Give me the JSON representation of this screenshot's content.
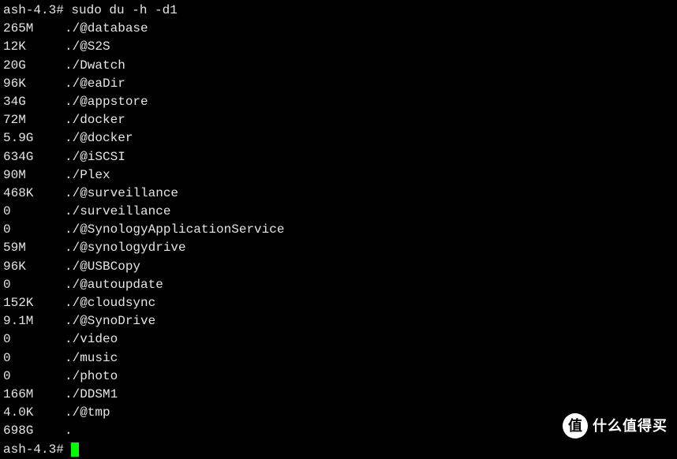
{
  "prompt": "ash-4.3#",
  "command": "sudo du -h -d1",
  "entries": [
    {
      "size": "265M",
      "path": "./@database"
    },
    {
      "size": "12K",
      "path": "./@S2S"
    },
    {
      "size": "20G",
      "path": "./Dwatch"
    },
    {
      "size": "96K",
      "path": "./@eaDir"
    },
    {
      "size": "34G",
      "path": "./@appstore"
    },
    {
      "size": "72M",
      "path": "./docker"
    },
    {
      "size": "5.9G",
      "path": "./@docker"
    },
    {
      "size": "634G",
      "path": "./@iSCSI"
    },
    {
      "size": "90M",
      "path": "./Plex"
    },
    {
      "size": "468K",
      "path": "./@surveillance"
    },
    {
      "size": "0",
      "path": "./surveillance"
    },
    {
      "size": "0",
      "path": "./@SynologyApplicationService"
    },
    {
      "size": "59M",
      "path": "./@synologydrive"
    },
    {
      "size": "96K",
      "path": "./@USBCopy"
    },
    {
      "size": "0",
      "path": "./@autoupdate"
    },
    {
      "size": "152K",
      "path": "./@cloudsync"
    },
    {
      "size": "9.1M",
      "path": "./@SynoDrive"
    },
    {
      "size": "0",
      "path": "./video"
    },
    {
      "size": "0",
      "path": "./music"
    },
    {
      "size": "0",
      "path": "./photo"
    },
    {
      "size": "166M",
      "path": "./DDSM1"
    },
    {
      "size": "4.0K",
      "path": "./@tmp"
    },
    {
      "size": "698G",
      "path": "."
    }
  ],
  "watermark": {
    "icon": "值",
    "text": "什么值得买"
  }
}
